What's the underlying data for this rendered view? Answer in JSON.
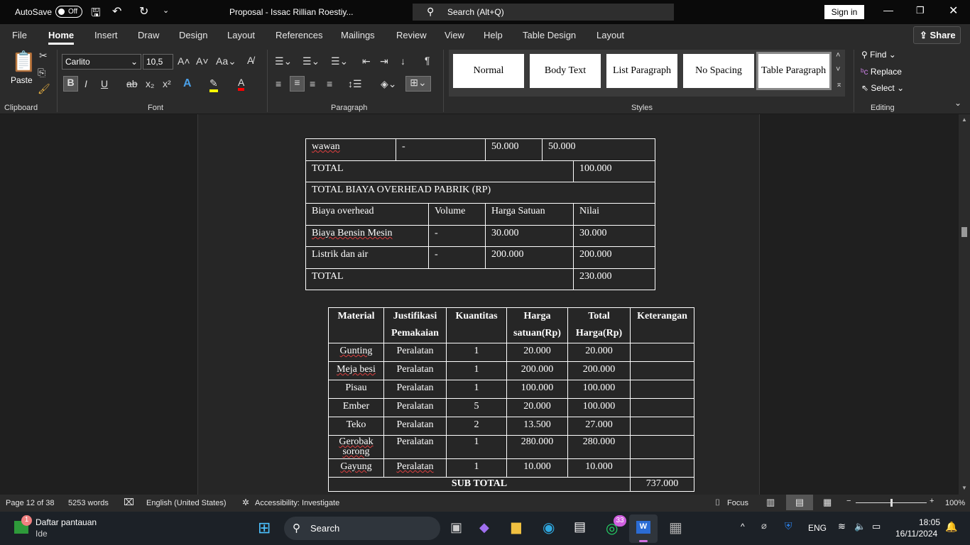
{
  "titlebar": {
    "autosave_label": "AutoSave",
    "autosave_state": "Off",
    "doc_title": "Proposal - Issac Rillian Roestiy...",
    "search_placeholder": "Search (Alt+Q)",
    "sign_in": "Sign in"
  },
  "tabs": [
    "File",
    "Home",
    "Insert",
    "Draw",
    "Design",
    "Layout",
    "References",
    "Mailings",
    "Review",
    "View",
    "Help",
    "Table Design",
    "Layout"
  ],
  "share_label": "Share",
  "ribbon": {
    "paste_label": "Paste",
    "font_name": "Carlito",
    "font_size": "10,5",
    "groups": {
      "clipboard": "Clipboard",
      "font": "Font",
      "paragraph": "Paragraph",
      "styles": "Styles",
      "editing": "Editing"
    },
    "styles": [
      "Normal",
      "Body Text",
      "List Paragraph",
      "No Spacing",
      "Table Paragraph"
    ],
    "editing": {
      "find": "Find",
      "replace": "Replace",
      "select": "Select"
    },
    "highlight_color": "#ffff00",
    "font_color": "#ff0000"
  },
  "table1": {
    "rows": [
      [
        "wawan",
        "-",
        "50.000",
        "50.000"
      ],
      [
        "TOTAL",
        "100.000"
      ],
      [
        "TOTAL BIAYA OVERHEAD PABRIK (RP)"
      ],
      [
        "Biaya overhead",
        "Volume",
        "Harga Satuan",
        "Nilai"
      ],
      [
        "Biaya Bensin Mesin",
        "-",
        "30.000",
        "30.000"
      ],
      [
        "Listrik dan air",
        "-",
        "200.000",
        "200.000"
      ],
      [
        "TOTAL",
        "230.000"
      ]
    ]
  },
  "table2": {
    "headers": [
      "Material",
      "Justifikasi Pemakaian",
      "Kuantitas",
      "Harga satuan(Rp)",
      "Total Harga(Rp)",
      "Keterangan"
    ],
    "rows": [
      [
        "Gunting",
        "Peralatan",
        "1",
        "20.000",
        "20.000",
        ""
      ],
      [
        "Meja besi",
        "Peralatan",
        "1",
        "200.000",
        "200.000",
        ""
      ],
      [
        "Pisau",
        "Peralatan",
        "1",
        "100.000",
        "100.000",
        ""
      ],
      [
        "Ember",
        "Peralatan",
        "5",
        "20.000",
        "100.000",
        ""
      ],
      [
        "Teko",
        "Peralatan",
        "2",
        "13.500",
        "27.000",
        ""
      ],
      [
        "Gerobak sorong",
        "Peralatan",
        "1",
        "280.000",
        "280.000",
        ""
      ],
      [
        "Gayung",
        "Peralatan",
        "1",
        "10.000",
        "10.000",
        ""
      ]
    ],
    "subtotal_label": "SUB TOTAL",
    "subtotal_value": "737.000"
  },
  "status": {
    "page": "Page 12 of 38",
    "words": "5253 words",
    "language": "English (United States)",
    "accessibility": "Accessibility: Investigate",
    "focus": "Focus",
    "zoom": "100%",
    "zoom_percent": 100
  },
  "taskbar": {
    "widget_title": "Daftar pantauan",
    "widget_sub": "Ide",
    "widget_badge": "1",
    "search": "Search",
    "whatsapp_badge": "33",
    "lang": "ENG",
    "time": "18:05",
    "date": "16/11/2024"
  }
}
